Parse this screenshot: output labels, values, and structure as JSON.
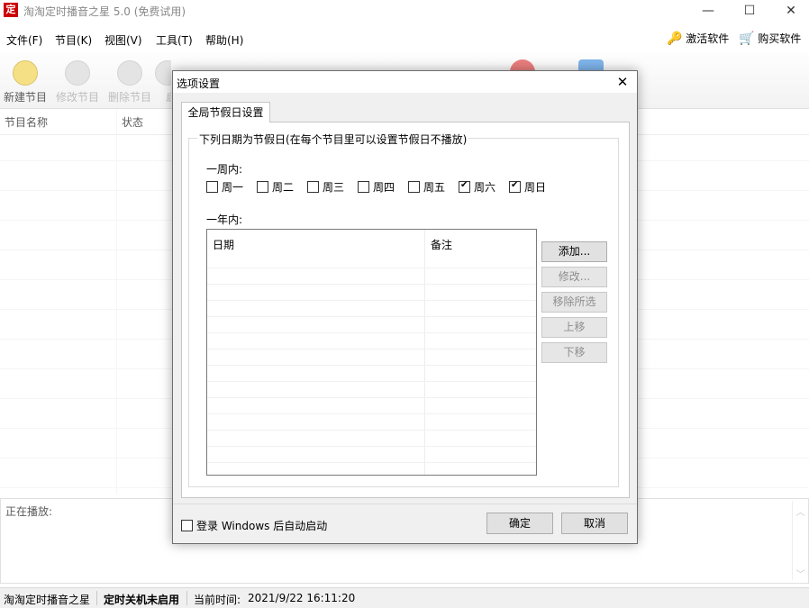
{
  "window": {
    "title": "淘淘定时播音之星 5.0 (免费试用)",
    "icon_glyph": "定",
    "minimize": "—",
    "maximize": "☐",
    "close": "✕"
  },
  "menu": {
    "items": [
      "文件(F)",
      "节目(K)",
      "视图(V)",
      "工具(T)",
      "帮助(H)"
    ],
    "activate": "激活软件",
    "buy": "购买软件"
  },
  "toolbar": {
    "buttons": [
      "新建节目",
      "修改节目",
      "删除节目",
      "启"
    ]
  },
  "list": {
    "col_name": "节目名称",
    "col_status": "状态"
  },
  "now_playing": {
    "label": "正在播放:"
  },
  "statusbar": {
    "app_name": "淘淘定时播音之星",
    "shutdown": "定时关机未启用",
    "time_label": "当前时间:",
    "time_value": "2021/9/22 16:11:20"
  },
  "dialog": {
    "title": "选项设置",
    "tab": "全局节假日设置",
    "group_title": "下列日期为节假日(在每个节目里可以设置节假日不播放)",
    "week_label": "一周内:",
    "weekdays": [
      {
        "label": "周一",
        "checked": false
      },
      {
        "label": "周二",
        "checked": false
      },
      {
        "label": "周三",
        "checked": false
      },
      {
        "label": "周四",
        "checked": false
      },
      {
        "label": "周五",
        "checked": false
      },
      {
        "label": "周六",
        "checked": true
      },
      {
        "label": "周日",
        "checked": true
      }
    ],
    "year_label": "一年内:",
    "table": {
      "col_date": "日期",
      "col_note": "备注"
    },
    "side_buttons": [
      {
        "label": "添加...",
        "enabled": true
      },
      {
        "label": "修改...",
        "enabled": false
      },
      {
        "label": "移除所选",
        "enabled": false
      },
      {
        "label": "上移",
        "enabled": false
      },
      {
        "label": "下移",
        "enabled": false
      }
    ],
    "autostart": "登录 Windows 后自动启动",
    "autostart_checked": false,
    "ok": "确定",
    "cancel": "取消"
  }
}
